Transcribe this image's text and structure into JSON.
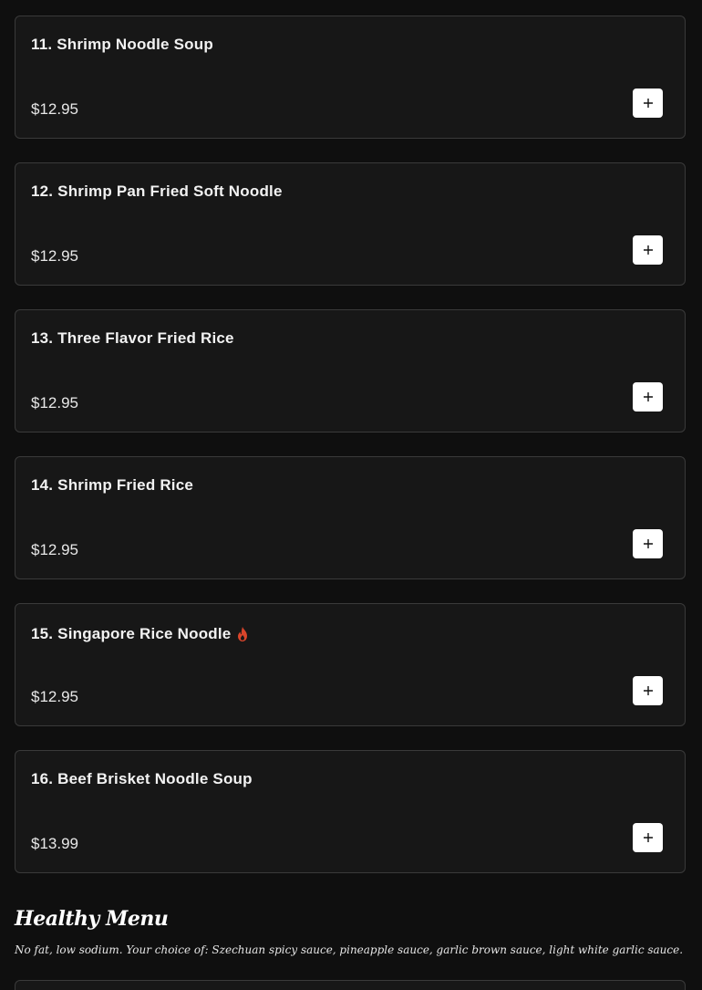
{
  "menu_items": [
    {
      "title": "11. Shrimp Noodle Soup",
      "price": "$12.95",
      "spicy": false
    },
    {
      "title": "12. Shrimp Pan Fried Soft Noodle",
      "price": "$12.95",
      "spicy": false
    },
    {
      "title": "13. Three Flavor Fried Rice",
      "price": "$12.95",
      "spicy": false
    },
    {
      "title": "14. Shrimp Fried Rice",
      "price": "$12.95",
      "spicy": false
    },
    {
      "title": "15. Singapore Rice Noodle",
      "price": "$12.95",
      "spicy": true
    },
    {
      "title": "16. Beef Brisket Noodle Soup",
      "price": "$13.99",
      "spicy": false
    }
  ],
  "section": {
    "title": "Healthy Menu",
    "description": "No fat, low sodium. Your choice of: Szechuan spicy sauce, pineapple sauce, garlic brown sauce, light white garlic sauce."
  },
  "colors": {
    "background": "#0f0f0f",
    "card_background": "#171717",
    "card_border": "#3a3a3a",
    "add_button": "#ffffff",
    "spicy_icon": "#d9452b"
  },
  "icons": {
    "add": "plus-icon",
    "spicy": "flame-icon"
  }
}
